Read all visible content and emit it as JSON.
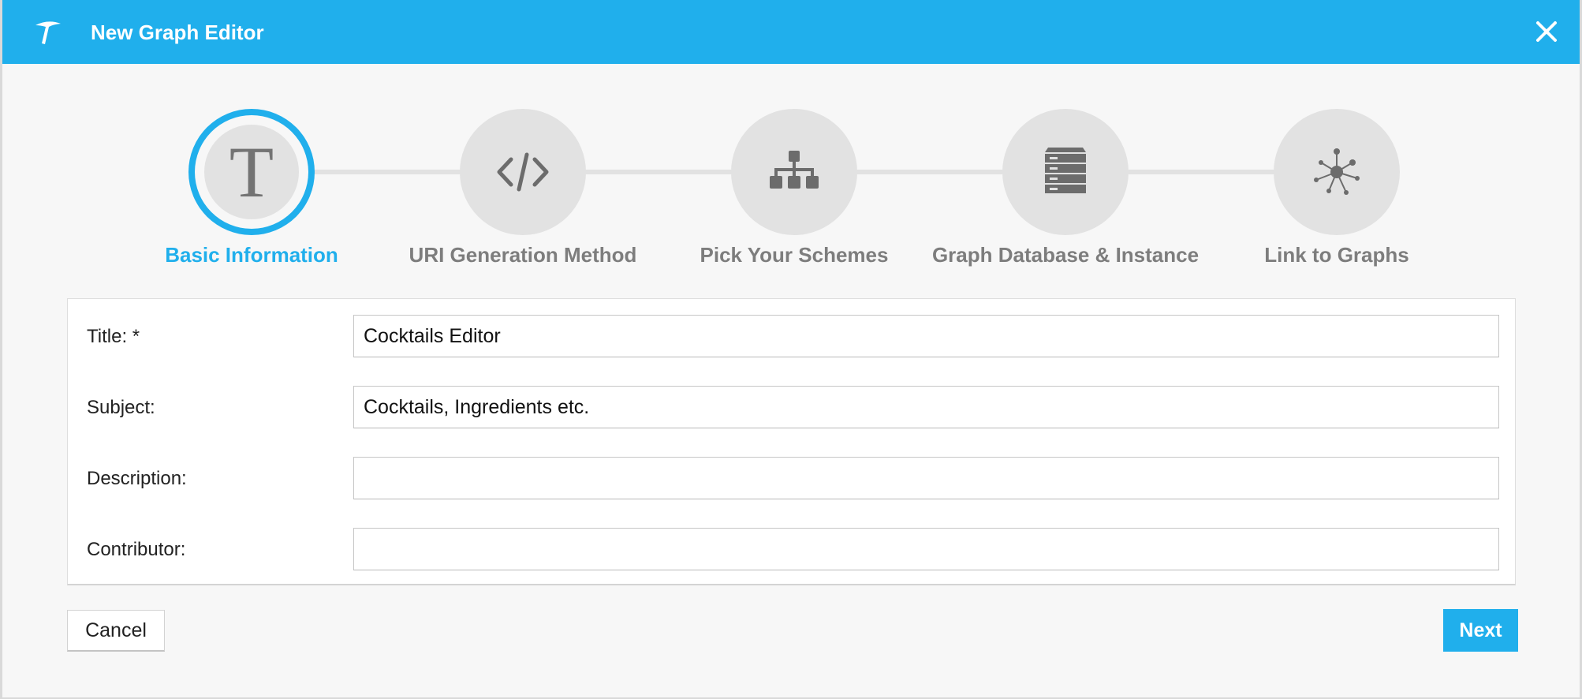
{
  "dialog": {
    "title": "New Graph Editor",
    "logo_icon": "pickaxe-logo-icon",
    "close_icon": "close-icon",
    "accent_color": "#20afec"
  },
  "steps": [
    {
      "label": "Basic Information",
      "icon": "serif-t-icon",
      "glyph": "T",
      "active": true
    },
    {
      "label": "URI Generation Method",
      "icon": "code-icon",
      "active": false
    },
    {
      "label": "Pick Your Schemes",
      "icon": "hierarchy-icon",
      "active": false
    },
    {
      "label": "Graph Database & Instance",
      "icon": "server-icon",
      "active": false
    },
    {
      "label": "Link to Graphs",
      "icon": "network-node-icon",
      "active": false
    }
  ],
  "form": {
    "title": {
      "label": "Title: *",
      "value": "Cocktails Editor"
    },
    "subject": {
      "label": "Subject:",
      "value": "Cocktails, Ingredients etc."
    },
    "description": {
      "label": "Description:",
      "value": ""
    },
    "contributor": {
      "label": "Contributor:",
      "value": ""
    }
  },
  "buttons": {
    "cancel": "Cancel",
    "next": "Next"
  }
}
